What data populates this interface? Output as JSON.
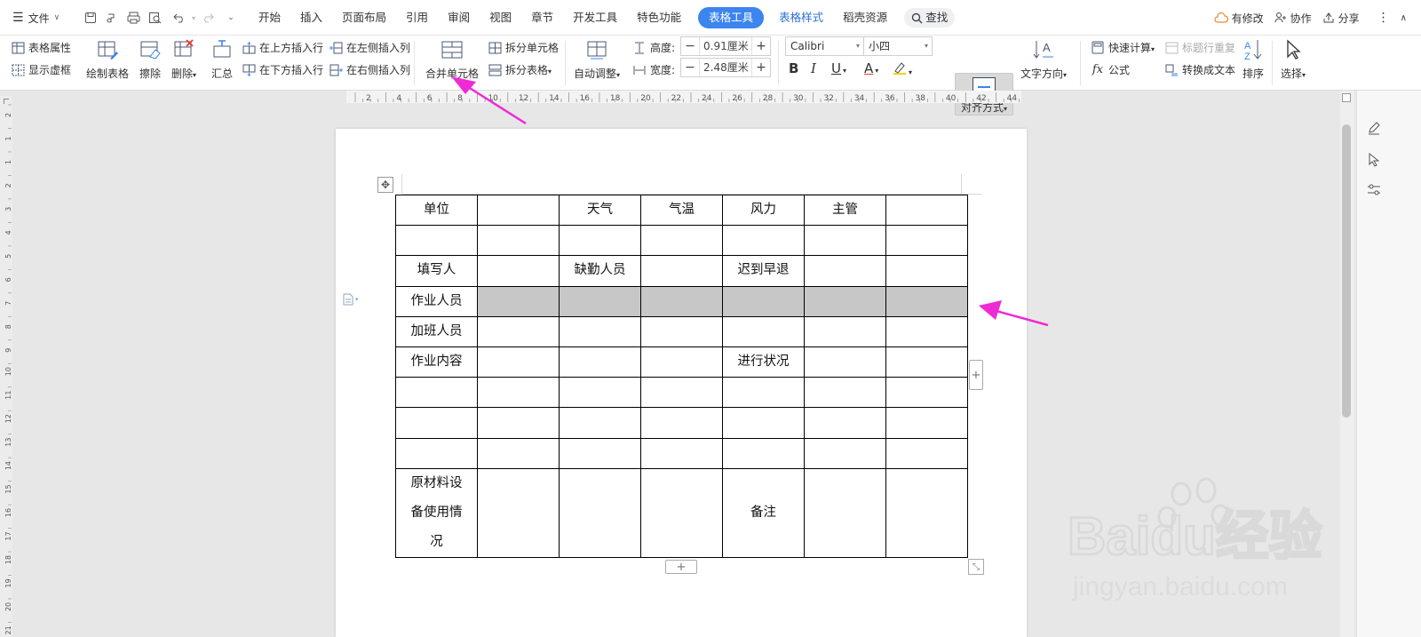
{
  "titlebar": {
    "file_label": "文件",
    "tabs": [
      "开始",
      "插入",
      "页面布局",
      "引用",
      "审阅",
      "视图",
      "章节",
      "开发工具",
      "特色功能"
    ],
    "active_tab": "表格工具",
    "extra_tabs": [
      "表格样式",
      "稻壳资源"
    ],
    "search_label": "查找",
    "right_items": [
      "有修改",
      "协作",
      "分享"
    ]
  },
  "ribbon": {
    "table_props": "表格属性",
    "show_grid": "显示虚框",
    "draw_table": "绘制表格",
    "erase": "擦除",
    "delete": "删除",
    "summary": "汇总",
    "insert_above": "在上方插入行",
    "insert_below": "在下方插入行",
    "insert_left": "在左侧插入列",
    "insert_right": "在右侧插入列",
    "merge_cells": "合并单元格",
    "split_cells": "拆分单元格",
    "split_table": "拆分表格",
    "auto_fit": "自动调整",
    "height_label": "高度:",
    "height_value": "0.91厘米",
    "width_label": "宽度:",
    "width_value": "2.48厘米",
    "font_name": "Calibri",
    "font_size": "小四",
    "align": "对齐方式",
    "text_direction": "文字方向",
    "quick_calc": "快速计算",
    "formula": "公式",
    "repeat_header": "标题行重复",
    "to_text": "转换成文本",
    "sort": "排序",
    "select": "选择"
  },
  "ruler": {
    "h_ticks": [
      "2",
      "4",
      "6",
      "8",
      "10",
      "12",
      "14",
      "16",
      "18",
      "20",
      "22",
      "24",
      "26",
      "28",
      "30",
      "32",
      "34",
      "36",
      "38",
      "40",
      "42",
      "44"
    ],
    "v_ticks": [
      "2",
      "1",
      "1",
      "2",
      "3",
      "4",
      "5",
      "6",
      "7",
      "8",
      "9",
      "10",
      "11",
      "12",
      "13",
      "14",
      "15",
      "16",
      "17",
      "18",
      "19",
      "20",
      "21"
    ]
  },
  "table": {
    "rows": [
      [
        "单位",
        "",
        "天气",
        "气温",
        "风力",
        "主管",
        ""
      ],
      [
        "",
        "",
        "",
        "",
        "",
        "",
        ""
      ],
      [
        "填写人",
        "",
        "缺勤人员",
        "",
        "迟到早退",
        "",
        ""
      ],
      [
        "作业人员",
        "",
        "",
        "",
        "",
        "",
        ""
      ],
      [
        "加班人员",
        "",
        "",
        "",
        "",
        "",
        ""
      ],
      [
        "作业内容",
        "",
        "",
        "",
        "进行状况",
        "",
        ""
      ],
      [
        "",
        "",
        "",
        "",
        "",
        "",
        ""
      ],
      [
        "",
        "",
        "",
        "",
        "",
        "",
        ""
      ],
      [
        "",
        "",
        "",
        "",
        "",
        "",
        ""
      ]
    ],
    "last_row": {
      "first_cell_lines": [
        "原材料设",
        "备使用情",
        "况"
      ],
      "note_label": "备注"
    },
    "selected_row_index": 3
  },
  "controls": {
    "add_symbol": "+"
  },
  "watermark": {
    "brand": "Baidu经验",
    "url": "jingyan.baidu.com"
  },
  "colors": {
    "active_tab": "#3c84ee",
    "arrow": "#ee2bd6",
    "selection": "#c7c7c7"
  }
}
